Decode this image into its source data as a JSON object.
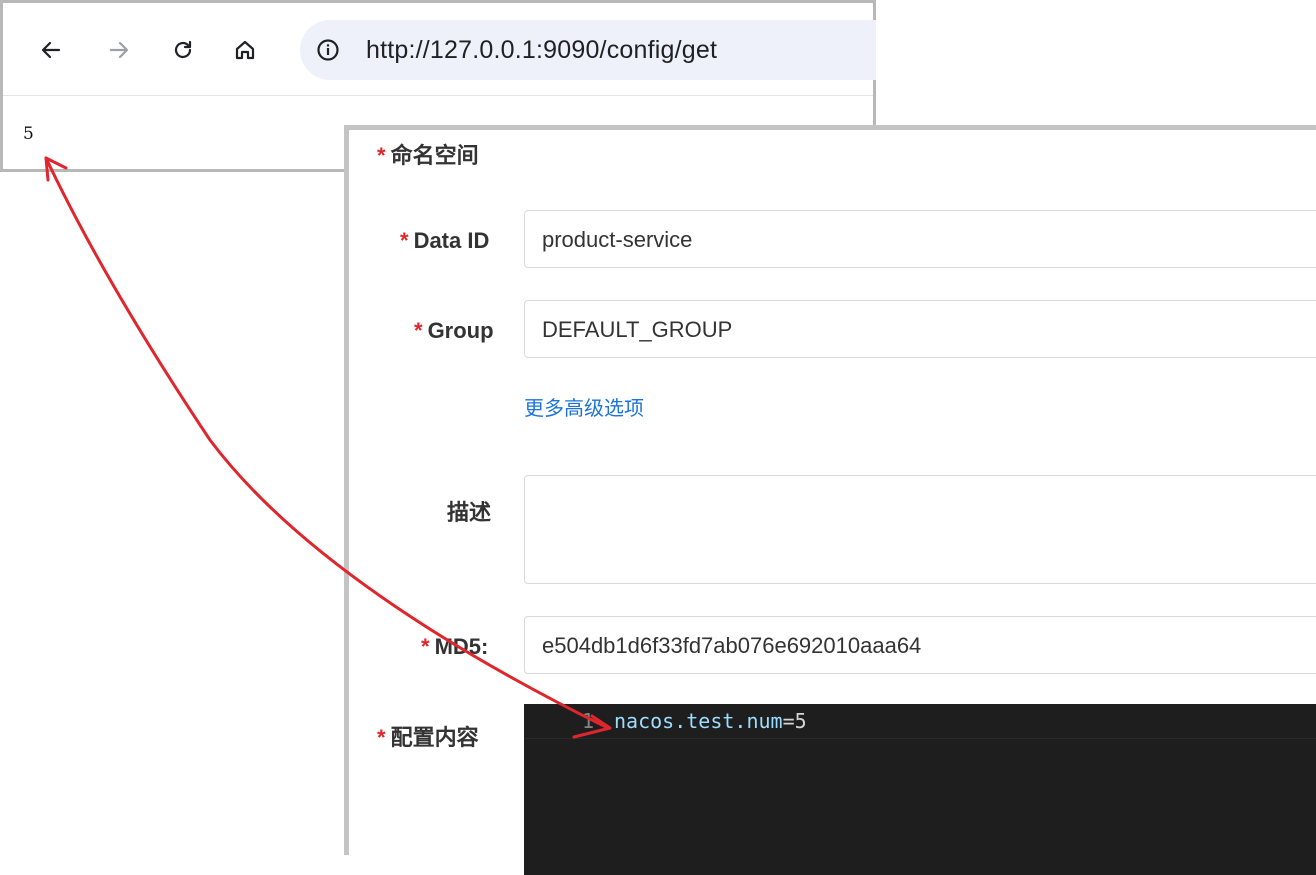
{
  "browser": {
    "url": "http://127.0.0.1:9090/config/get",
    "response_body": "5",
    "nav": {
      "back_icon": "arrow-left-icon",
      "forward_icon": "arrow-right-icon",
      "reload_icon": "reload-icon",
      "home_icon": "home-icon",
      "info_icon": "info-circle-icon"
    }
  },
  "form": {
    "namespace_label": "命名空间",
    "data_id_label": "Data ID",
    "data_id_value": "product-service",
    "group_label": "Group",
    "group_value": "DEFAULT_GROUP",
    "advanced_link": "更多高级选项",
    "description_label": "描述",
    "description_value": "",
    "md5_label": "MD5:",
    "md5_value": "e504db1d6f33fd7ab076e692010aaa64",
    "content_label": "配置内容",
    "required_mark": "*"
  },
  "editor": {
    "line_number": "1",
    "code_key": "nacos.test.num",
    "code_eq": "=",
    "code_value": "5"
  },
  "colors": {
    "required": "#e0262d",
    "link": "#1e73d8",
    "editor_bg": "#1e1e1e",
    "arrow": "#e0262d"
  }
}
